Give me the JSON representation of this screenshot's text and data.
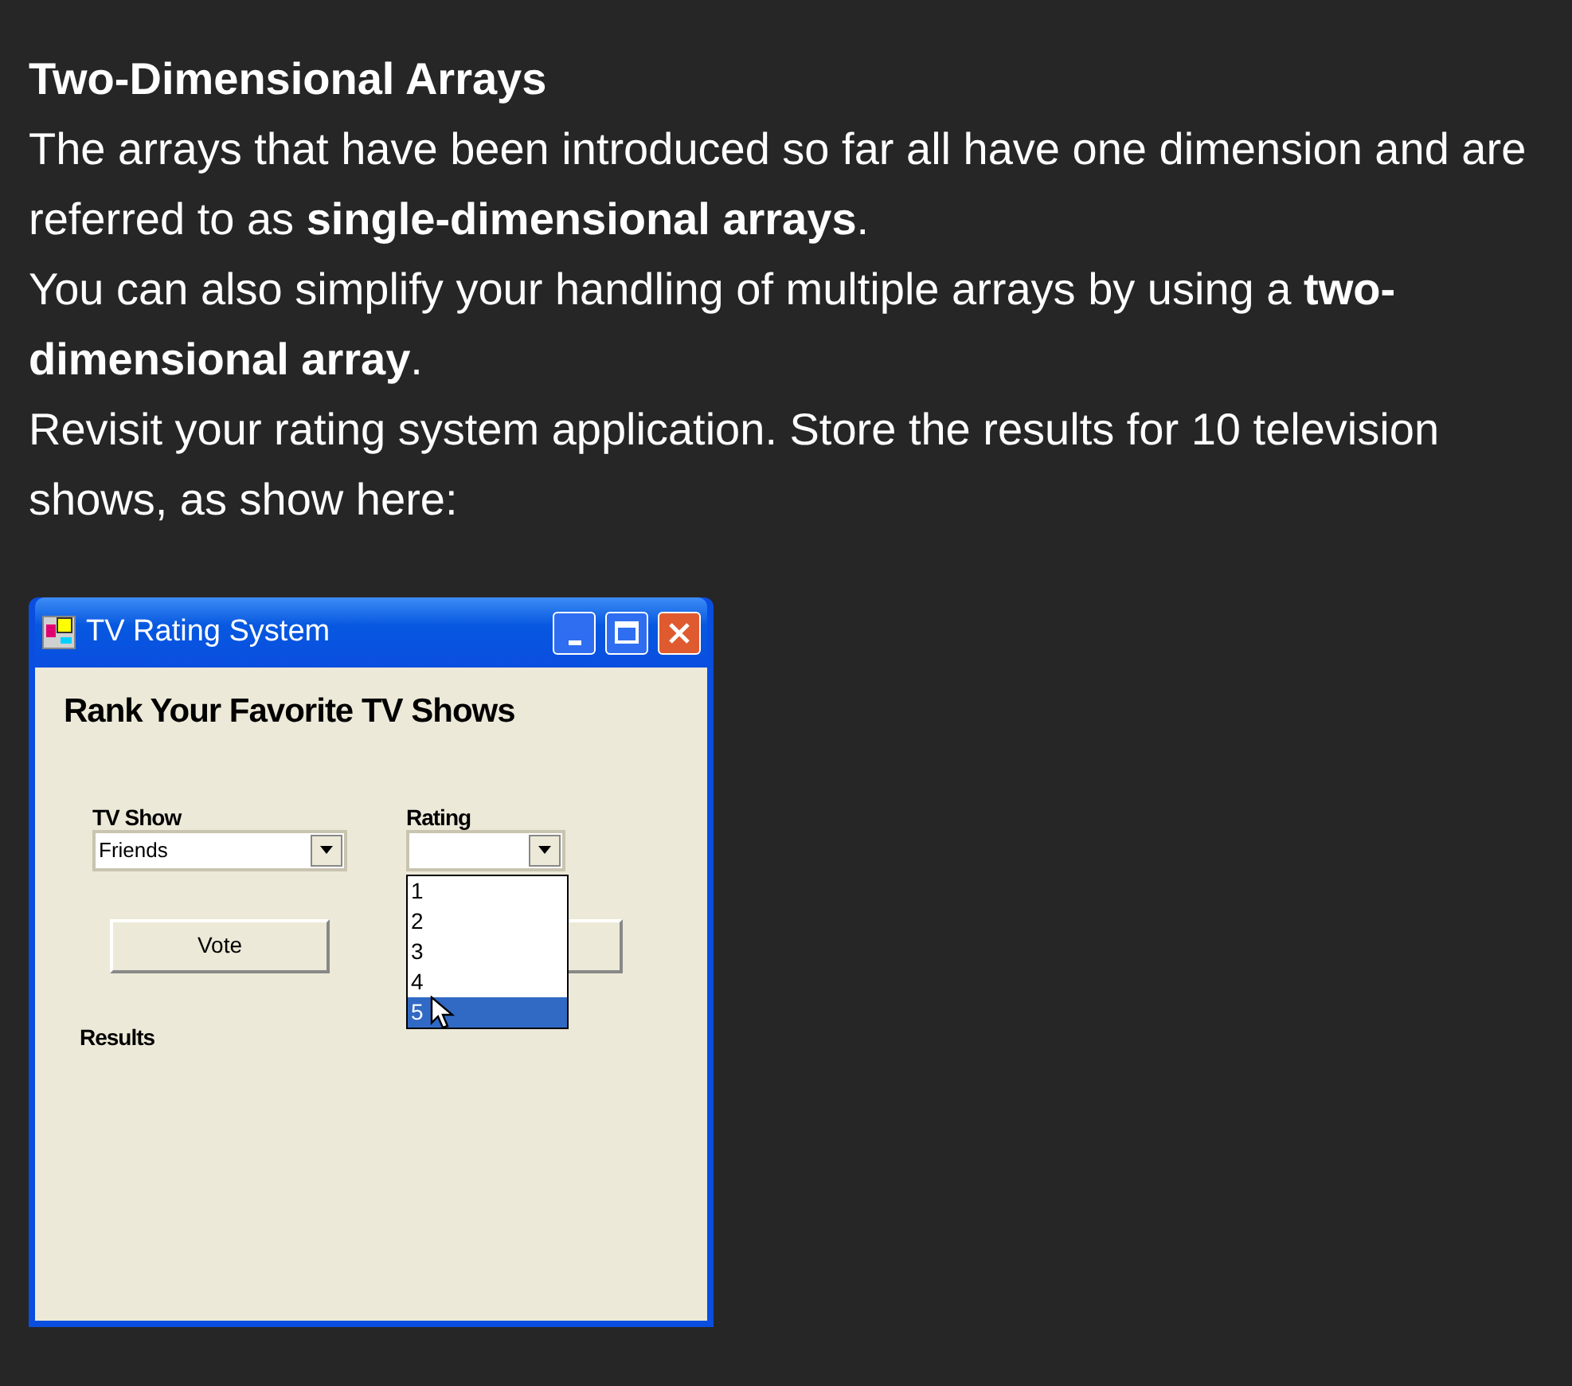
{
  "heading": "Two-Dimensional Arrays",
  "paragraphs": [
    "The arrays that have been introduced so far all have one dimension and are referred to as **single-dimensional arrays**.",
    "You can also simplify your handling of multiple arrays by using a **two-dimensional array**.",
    "Revisit your rating system application. Store the results for 10 television shows, as show here:"
  ],
  "window": {
    "title": "TV Rating System",
    "heading": "Rank Your Favorite TV Shows",
    "show_label": "TV Show",
    "show_value": "Friends",
    "rating_label": "Rating",
    "rating_options": [
      {
        "label": "1",
        "selected": false
      },
      {
        "label": "2",
        "selected": false
      },
      {
        "label": "3",
        "selected": false
      },
      {
        "label": "4",
        "selected": false
      },
      {
        "label": "5",
        "selected": true
      }
    ],
    "vote_button": "Vote",
    "results_label": "Results"
  }
}
